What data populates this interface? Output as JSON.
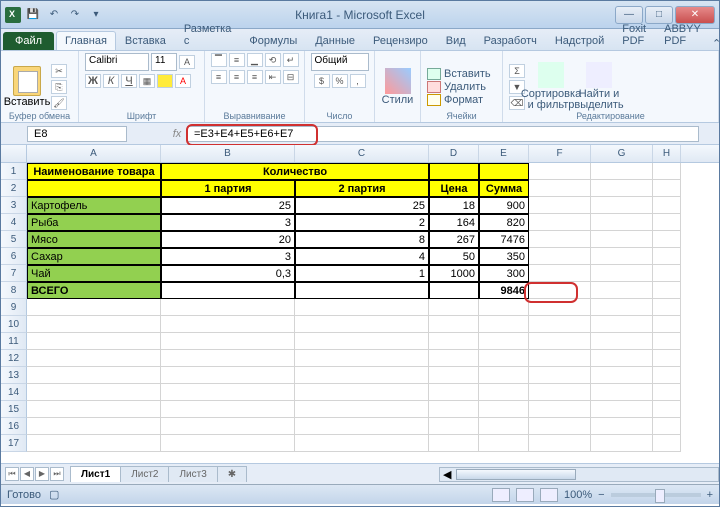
{
  "window": {
    "title": "Книга1 - Microsoft Excel"
  },
  "qat": {
    "save": "💾",
    "undo": "↶",
    "redo": "↷"
  },
  "tabs": {
    "file": "Файл",
    "home": "Главная",
    "insert": "Вставка",
    "layout": "Разметка с",
    "formulas": "Формулы",
    "data": "Данные",
    "review": "Рецензиро",
    "view": "Вид",
    "dev": "Разработч",
    "addins": "Надстрой",
    "foxit": "Foxit PDF",
    "abbyy": "ABBYY PDF"
  },
  "ribbon": {
    "clipboard": {
      "label": "Буфер обмена",
      "paste": "Вставить"
    },
    "font": {
      "label": "Шрифт",
      "name": "Calibri",
      "size": "11"
    },
    "align": {
      "label": "Выравнивание"
    },
    "number": {
      "label": "Число",
      "format": "Общий"
    },
    "styles": {
      "label": "Стили",
      "s": "Стили"
    },
    "cells": {
      "label": "Ячейки",
      "insert": "Вставить",
      "delete": "Удалить",
      "format": "Формат"
    },
    "editing": {
      "label": "Редактирование",
      "sort": "Сортировка и фильтр",
      "find": "Найти и выделить"
    }
  },
  "namebox": "E8",
  "formula": "=E3+E4+E5+E6+E7",
  "cols": [
    "A",
    "B",
    "C",
    "D",
    "E",
    "F",
    "G",
    "H"
  ],
  "headers": {
    "name": "Наименование товара",
    "qty": "Количество",
    "b1": "1 партия",
    "b2": "2 партия",
    "price": "Цена",
    "sum": "Сумма"
  },
  "rows": [
    {
      "n": "Картофель",
      "b": "25",
      "c": "25",
      "d": "18",
      "e": "900"
    },
    {
      "n": "Рыба",
      "b": "3",
      "c": "2",
      "d": "164",
      "e": "820"
    },
    {
      "n": "Мясо",
      "b": "20",
      "c": "8",
      "d": "267",
      "e": "7476"
    },
    {
      "n": "Сахар",
      "b": "3",
      "c": "4",
      "d": "50",
      "e": "350"
    },
    {
      "n": "Чай",
      "b": "0,3",
      "c": "1",
      "d": "1000",
      "e": "300"
    }
  ],
  "total": {
    "label": "ВСЕГО",
    "sum": "9846"
  },
  "sheets": {
    "s1": "Лист1",
    "s2": "Лист2",
    "s3": "Лист3"
  },
  "status": {
    "ready": "Готово",
    "zoom": "100%"
  }
}
